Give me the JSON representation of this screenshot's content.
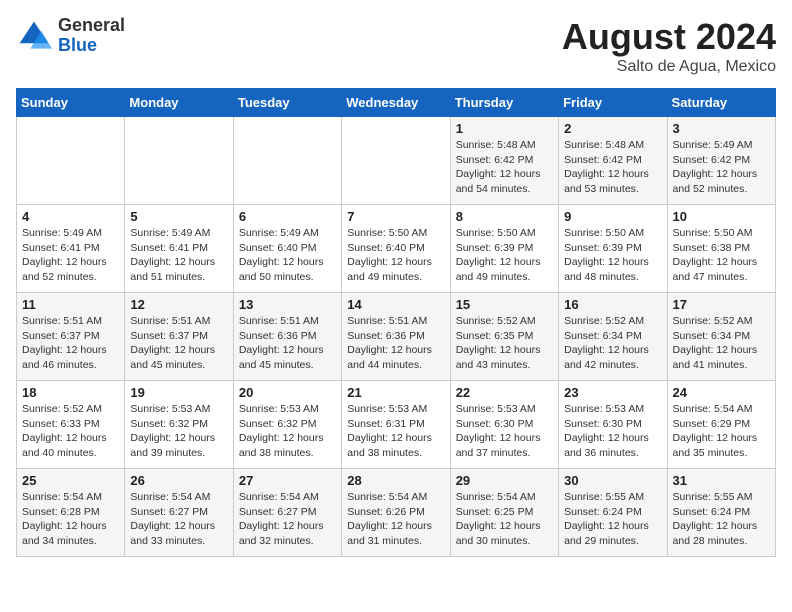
{
  "logo": {
    "general": "General",
    "blue": "Blue"
  },
  "title": "August 2024",
  "location": "Salto de Agua, Mexico",
  "days_of_week": [
    "Sunday",
    "Monday",
    "Tuesday",
    "Wednesday",
    "Thursday",
    "Friday",
    "Saturday"
  ],
  "weeks": [
    [
      {
        "day": "",
        "details": ""
      },
      {
        "day": "",
        "details": ""
      },
      {
        "day": "",
        "details": ""
      },
      {
        "day": "",
        "details": ""
      },
      {
        "day": "1",
        "details": "Sunrise: 5:48 AM\nSunset: 6:42 PM\nDaylight: 12 hours\nand 54 minutes."
      },
      {
        "day": "2",
        "details": "Sunrise: 5:48 AM\nSunset: 6:42 PM\nDaylight: 12 hours\nand 53 minutes."
      },
      {
        "day": "3",
        "details": "Sunrise: 5:49 AM\nSunset: 6:42 PM\nDaylight: 12 hours\nand 52 minutes."
      }
    ],
    [
      {
        "day": "4",
        "details": "Sunrise: 5:49 AM\nSunset: 6:41 PM\nDaylight: 12 hours\nand 52 minutes."
      },
      {
        "day": "5",
        "details": "Sunrise: 5:49 AM\nSunset: 6:41 PM\nDaylight: 12 hours\nand 51 minutes."
      },
      {
        "day": "6",
        "details": "Sunrise: 5:49 AM\nSunset: 6:40 PM\nDaylight: 12 hours\nand 50 minutes."
      },
      {
        "day": "7",
        "details": "Sunrise: 5:50 AM\nSunset: 6:40 PM\nDaylight: 12 hours\nand 49 minutes."
      },
      {
        "day": "8",
        "details": "Sunrise: 5:50 AM\nSunset: 6:39 PM\nDaylight: 12 hours\nand 49 minutes."
      },
      {
        "day": "9",
        "details": "Sunrise: 5:50 AM\nSunset: 6:39 PM\nDaylight: 12 hours\nand 48 minutes."
      },
      {
        "day": "10",
        "details": "Sunrise: 5:50 AM\nSunset: 6:38 PM\nDaylight: 12 hours\nand 47 minutes."
      }
    ],
    [
      {
        "day": "11",
        "details": "Sunrise: 5:51 AM\nSunset: 6:37 PM\nDaylight: 12 hours\nand 46 minutes."
      },
      {
        "day": "12",
        "details": "Sunrise: 5:51 AM\nSunset: 6:37 PM\nDaylight: 12 hours\nand 45 minutes."
      },
      {
        "day": "13",
        "details": "Sunrise: 5:51 AM\nSunset: 6:36 PM\nDaylight: 12 hours\nand 45 minutes."
      },
      {
        "day": "14",
        "details": "Sunrise: 5:51 AM\nSunset: 6:36 PM\nDaylight: 12 hours\nand 44 minutes."
      },
      {
        "day": "15",
        "details": "Sunrise: 5:52 AM\nSunset: 6:35 PM\nDaylight: 12 hours\nand 43 minutes."
      },
      {
        "day": "16",
        "details": "Sunrise: 5:52 AM\nSunset: 6:34 PM\nDaylight: 12 hours\nand 42 minutes."
      },
      {
        "day": "17",
        "details": "Sunrise: 5:52 AM\nSunset: 6:34 PM\nDaylight: 12 hours\nand 41 minutes."
      }
    ],
    [
      {
        "day": "18",
        "details": "Sunrise: 5:52 AM\nSunset: 6:33 PM\nDaylight: 12 hours\nand 40 minutes."
      },
      {
        "day": "19",
        "details": "Sunrise: 5:53 AM\nSunset: 6:32 PM\nDaylight: 12 hours\nand 39 minutes."
      },
      {
        "day": "20",
        "details": "Sunrise: 5:53 AM\nSunset: 6:32 PM\nDaylight: 12 hours\nand 38 minutes."
      },
      {
        "day": "21",
        "details": "Sunrise: 5:53 AM\nSunset: 6:31 PM\nDaylight: 12 hours\nand 38 minutes."
      },
      {
        "day": "22",
        "details": "Sunrise: 5:53 AM\nSunset: 6:30 PM\nDaylight: 12 hours\nand 37 minutes."
      },
      {
        "day": "23",
        "details": "Sunrise: 5:53 AM\nSunset: 6:30 PM\nDaylight: 12 hours\nand 36 minutes."
      },
      {
        "day": "24",
        "details": "Sunrise: 5:54 AM\nSunset: 6:29 PM\nDaylight: 12 hours\nand 35 minutes."
      }
    ],
    [
      {
        "day": "25",
        "details": "Sunrise: 5:54 AM\nSunset: 6:28 PM\nDaylight: 12 hours\nand 34 minutes."
      },
      {
        "day": "26",
        "details": "Sunrise: 5:54 AM\nSunset: 6:27 PM\nDaylight: 12 hours\nand 33 minutes."
      },
      {
        "day": "27",
        "details": "Sunrise: 5:54 AM\nSunset: 6:27 PM\nDaylight: 12 hours\nand 32 minutes."
      },
      {
        "day": "28",
        "details": "Sunrise: 5:54 AM\nSunset: 6:26 PM\nDaylight: 12 hours\nand 31 minutes."
      },
      {
        "day": "29",
        "details": "Sunrise: 5:54 AM\nSunset: 6:25 PM\nDaylight: 12 hours\nand 30 minutes."
      },
      {
        "day": "30",
        "details": "Sunrise: 5:55 AM\nSunset: 6:24 PM\nDaylight: 12 hours\nand 29 minutes."
      },
      {
        "day": "31",
        "details": "Sunrise: 5:55 AM\nSunset: 6:24 PM\nDaylight: 12 hours\nand 28 minutes."
      }
    ]
  ]
}
